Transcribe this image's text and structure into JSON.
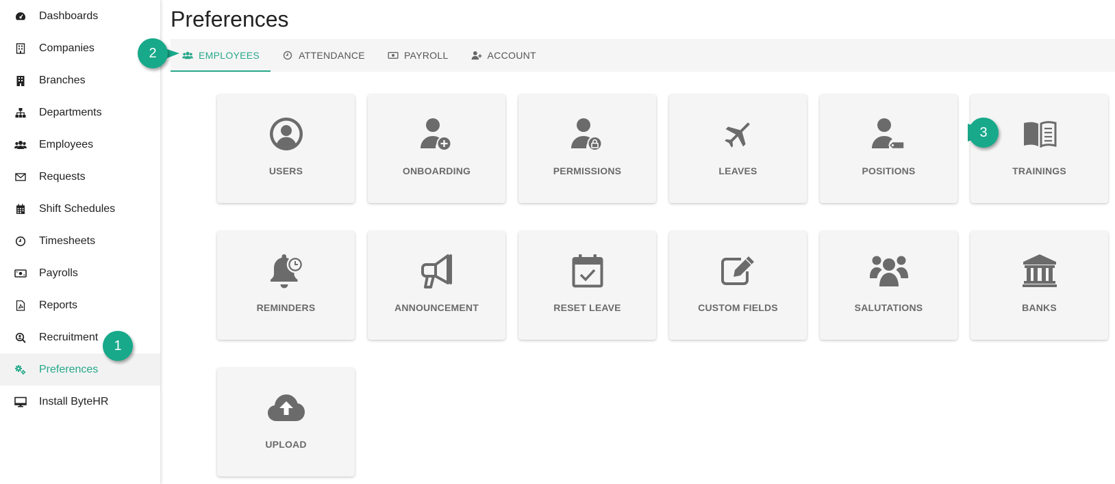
{
  "sidebar": {
    "items": [
      {
        "label": "Dashboards",
        "icon": "dashboard-gauge-icon"
      },
      {
        "label": "Companies",
        "icon": "building-icon"
      },
      {
        "label": "Branches",
        "icon": "office-building-icon"
      },
      {
        "label": "Departments",
        "icon": "sitemap-icon"
      },
      {
        "label": "Employees",
        "icon": "users-icon"
      },
      {
        "label": "Requests",
        "icon": "envelope-icon"
      },
      {
        "label": "Shift Schedules",
        "icon": "calendar-icon"
      },
      {
        "label": "Timesheets",
        "icon": "clock-icon"
      },
      {
        "label": "Payrolls",
        "icon": "money-bill-icon"
      },
      {
        "label": "Reports",
        "icon": "file-pdf-icon"
      },
      {
        "label": "Recruitment",
        "icon": "search-user-icon"
      },
      {
        "label": "Preferences",
        "icon": "gears-icon",
        "active": true
      },
      {
        "label": "Install ByteHR",
        "icon": "desktop-icon"
      }
    ]
  },
  "page": {
    "title": "Preferences"
  },
  "tabs": [
    {
      "label": "EMPLOYEES",
      "icon": "users-icon",
      "active": true
    },
    {
      "label": "ATTENDANCE",
      "icon": "clock-icon"
    },
    {
      "label": "PAYROLL",
      "icon": "money-bill-icon"
    },
    {
      "label": "ACCOUNT",
      "icon": "user-plus-icon"
    }
  ],
  "cards": [
    {
      "label": "USERS",
      "icon": "user-circle-icon"
    },
    {
      "label": "ONBOARDING",
      "icon": "user-add-icon"
    },
    {
      "label": "PERMISSIONS",
      "icon": "user-lock-icon"
    },
    {
      "label": "LEAVES",
      "icon": "plane-icon"
    },
    {
      "label": "POSITIONS",
      "icon": "user-tag-icon"
    },
    {
      "label": "TRAININGS",
      "icon": "book-open-icon"
    },
    {
      "label": "REMINDERS",
      "icon": "bell-clock-icon"
    },
    {
      "label": "ANNOUNCEMENT",
      "icon": "megaphone-icon"
    },
    {
      "label": "RESET LEAVE",
      "icon": "calendar-check-icon"
    },
    {
      "label": "CUSTOM FIELDS",
      "icon": "edit-icon"
    },
    {
      "label": "SALUTATIONS",
      "icon": "users-group-icon"
    },
    {
      "label": "BANKS",
      "icon": "bank-icon"
    },
    {
      "label": "UPLOAD",
      "icon": "cloud-upload-icon"
    }
  ],
  "callouts": [
    {
      "number": "1",
      "target": "Preferences"
    },
    {
      "number": "2",
      "target": "EMPLOYEES"
    },
    {
      "number": "3",
      "target": "TRAININGS"
    }
  ],
  "colors": {
    "accent": "#26a88a",
    "callout": "#17a98a",
    "card_bg": "#f5f5f5",
    "icon": "#6b6b6b"
  }
}
